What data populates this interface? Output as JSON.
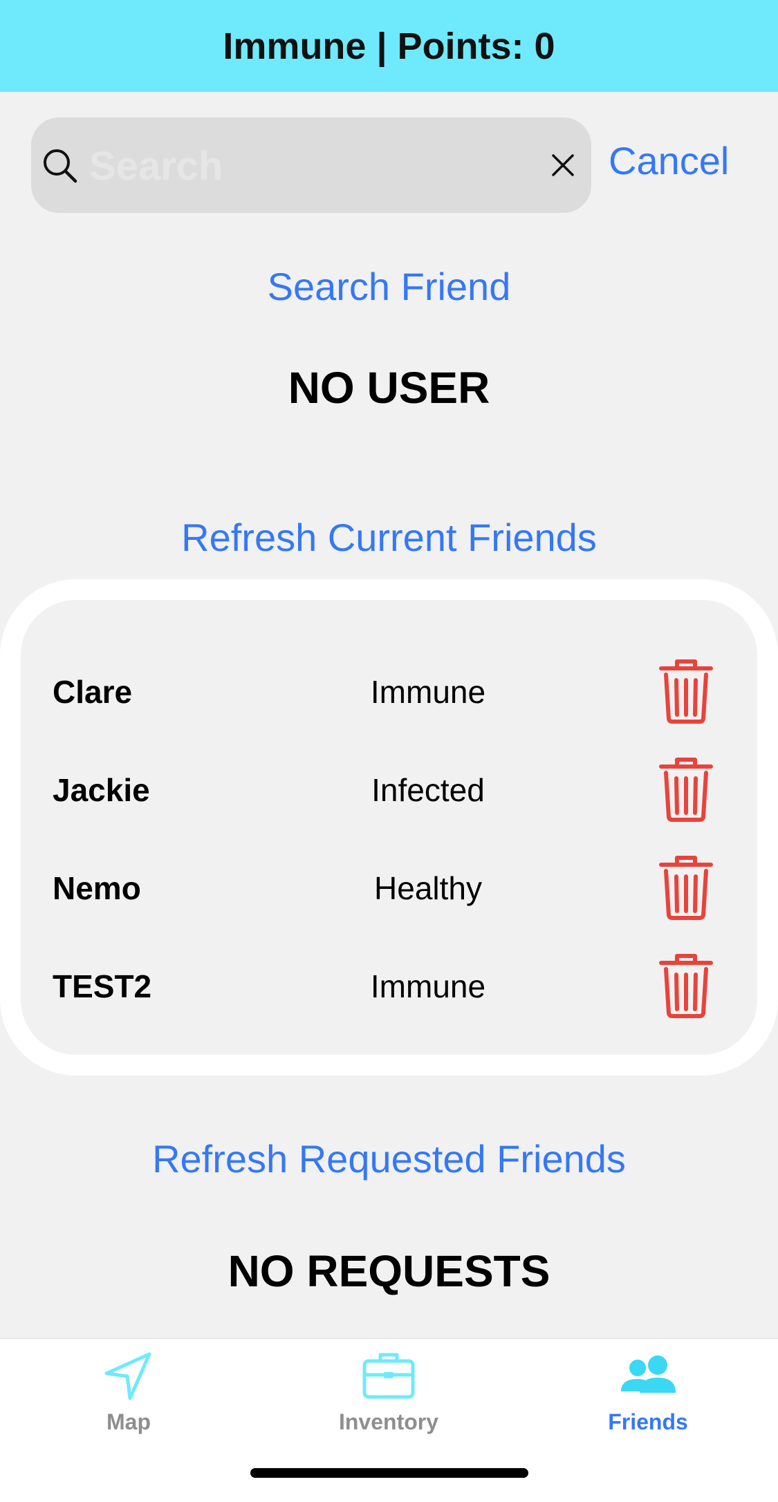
{
  "header": {
    "title": "Immune | Points: 0"
  },
  "search": {
    "placeholder": "Search",
    "value": "",
    "cancel_label": "Cancel"
  },
  "search_friend_label": "Search Friend",
  "search_result_label": "NO USER",
  "refresh_current_label": "Refresh Current Friends",
  "friends": [
    {
      "name": "Clare",
      "status": "Immune"
    },
    {
      "name": "Jackie",
      "status": "Infected"
    },
    {
      "name": "Nemo",
      "status": "Healthy"
    },
    {
      "name": "TEST2",
      "status": "Immune"
    }
  ],
  "refresh_requested_label": "Refresh Requested Friends",
  "requests_label": "NO REQUESTS",
  "tabs": [
    {
      "label": "Map",
      "icon": "location-arrow-icon",
      "active": false
    },
    {
      "label": "Inventory",
      "icon": "briefcase-icon",
      "active": false
    },
    {
      "label": "Friends",
      "icon": "people-icon",
      "active": true
    }
  ],
  "colors": {
    "header_bg": "#6feafc",
    "accent_blue": "#3478f6",
    "delete_red": "#e8433b",
    "tab_inactive_icon": "#6feafc",
    "tab_inactive_label": "#8e8e8e"
  }
}
